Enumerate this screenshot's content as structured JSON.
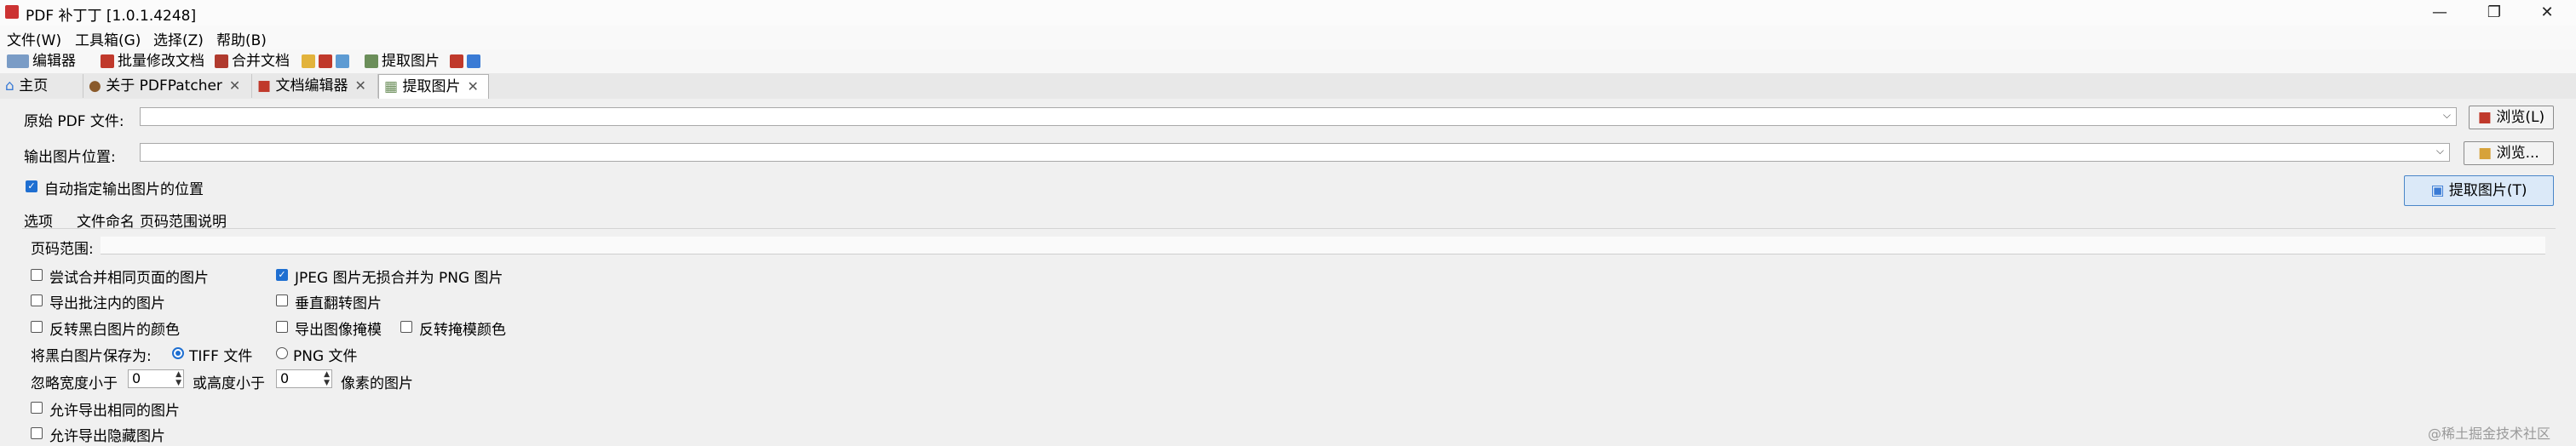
{
  "window": {
    "title": "PDF 补丁丁 [1.0.1.4248]",
    "minimize_icon": "minimize-icon",
    "maximize_icon": "maximize-icon",
    "close_icon": "close-icon"
  },
  "menu": [
    "文件(W)",
    "工具箱(G)",
    "选择(Z)",
    "帮助(B)"
  ],
  "toolbar": {
    "editor": "编辑器",
    "batch": "批量修改文档",
    "merge": "合并文档",
    "extract": "提取图片"
  },
  "tabs": [
    "主页",
    "关于 PDFPatcher",
    "文档编辑器",
    "提取图片"
  ],
  "form": {
    "source_label": "原始 PDF 文件:",
    "source_value": "",
    "source_browse": "浏览(L)",
    "output_label": "输出图片位置:",
    "output_value": "",
    "output_browse": "浏览...",
    "auto_output": "自动指定输出图片的位置",
    "extract_button": "提取图片(T)"
  },
  "options_tabs": [
    "选项",
    "文件命名",
    "页码范围说明"
  ],
  "options": {
    "page_range_label": "页码范围:",
    "page_range_value": "",
    "merge_same_page": "尝试合并相同页面的图片",
    "jpeg_to_png": "JPEG 图片无损合并为 PNG 图片",
    "export_annotations": "导出批注内的图片",
    "flip_vertical": "垂直翻转图片",
    "invert_bw": "反转黑白图片的颜色",
    "export_mask": "导出图像掩模",
    "invert_mask": "反转掩模颜色",
    "save_bw_as": "将黑白图片保存为:",
    "tiff": "TIFF 文件",
    "png": "PNG 文件",
    "ignore_width": "忽略宽度小于",
    "width_value": "0",
    "or_height": "或高度小于",
    "height_value": "0",
    "pixel_images": "像素的图片",
    "allow_same": "允许导出相同的图片",
    "allow_hidden": "允许导出隐藏图片"
  },
  "watermark": "@稀土掘金技术社区"
}
